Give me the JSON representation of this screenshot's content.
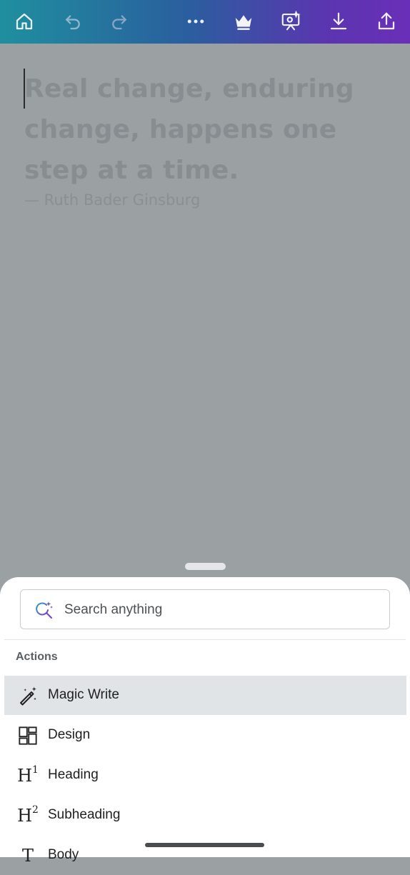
{
  "toolbar": {
    "icons": [
      "home-icon",
      "undo-icon",
      "redo-icon",
      "more-icon",
      "crown-icon",
      "present-icon",
      "download-icon",
      "share-icon"
    ]
  },
  "canvas": {
    "quote_lines": [
      "Real change, enduring",
      "change, happens one",
      "step at a time."
    ],
    "author": "— Ruth Bader Ginsburg"
  },
  "sheet": {
    "search_placeholder": "Search anything",
    "section_title": "Actions",
    "items": [
      {
        "label": "Magic Write",
        "icon": "magic-wand-icon",
        "selected": true
      },
      {
        "label": "Design",
        "icon": "layout-icon",
        "selected": false
      },
      {
        "label": "Heading",
        "icon": "heading1-icon",
        "selected": false
      },
      {
        "label": "Subheading",
        "icon": "heading2-icon",
        "selected": false
      },
      {
        "label": "Body",
        "icon": "text-icon",
        "selected": false
      }
    ]
  },
  "colors": {
    "toolbar_gradient": [
      "#1f8f9f",
      "#6a2fb8"
    ],
    "overlay": "#9ba0a3",
    "selected_row": "#e1e4e6"
  }
}
